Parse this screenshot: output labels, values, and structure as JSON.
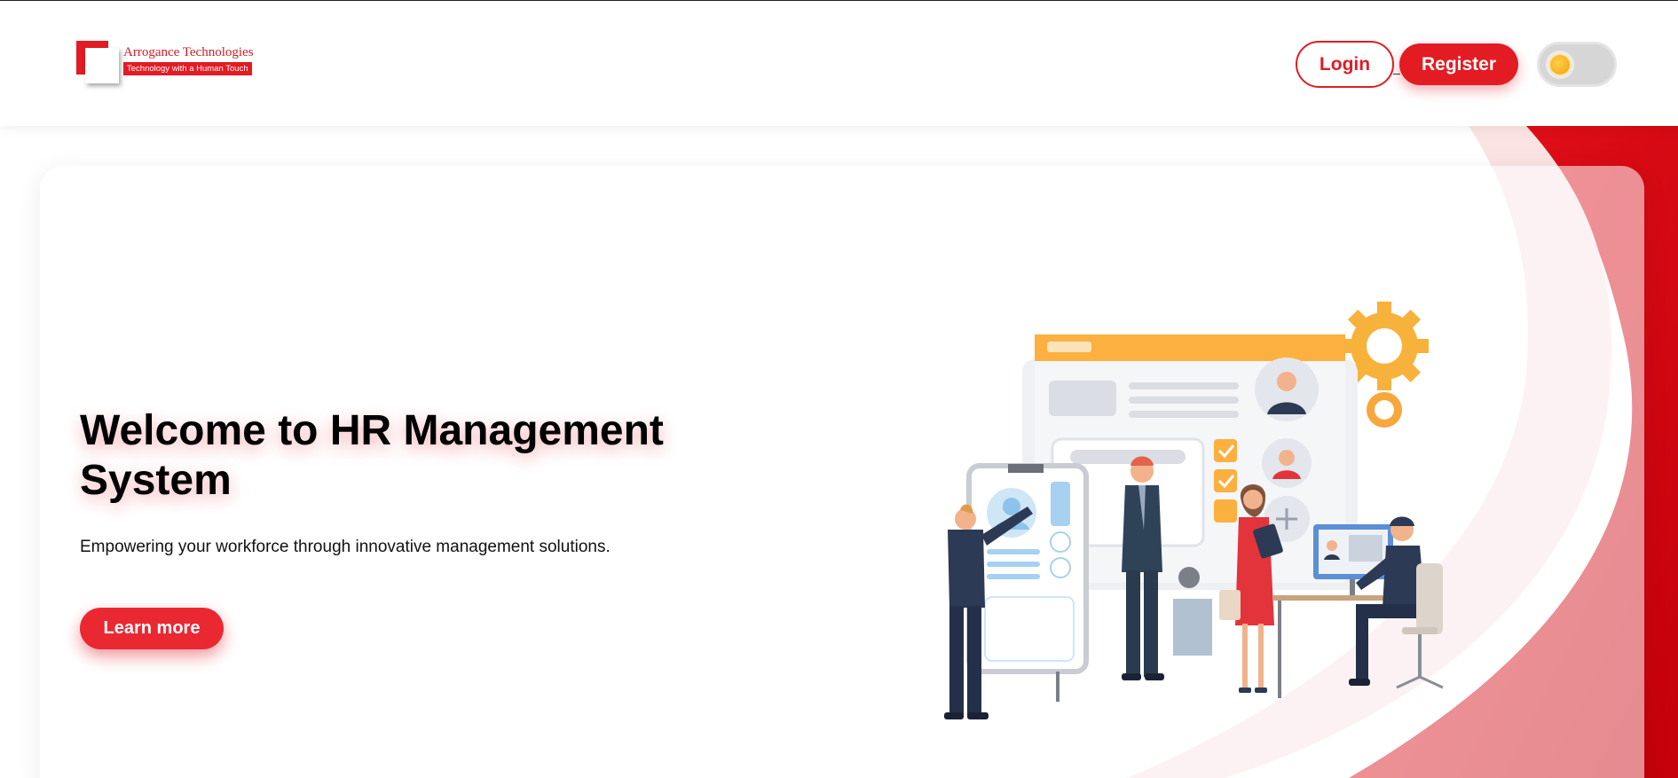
{
  "brand": {
    "name": "Arrogance Technologies",
    "tagline": "Technology with a Human Touch"
  },
  "header": {
    "login_label": "Login",
    "register_label": "Register",
    "theme_toggle": {
      "state": "light",
      "icon": "sun-icon"
    }
  },
  "hero": {
    "title": "Welcome to HR Management System",
    "subtitle": "Empowering your workforce through innovative management solutions.",
    "cta_label": "Learn more"
  },
  "colors": {
    "accent": "#e31b23",
    "accent_soft": "#fbe1e2",
    "illustration_orange": "#f7a73b"
  }
}
